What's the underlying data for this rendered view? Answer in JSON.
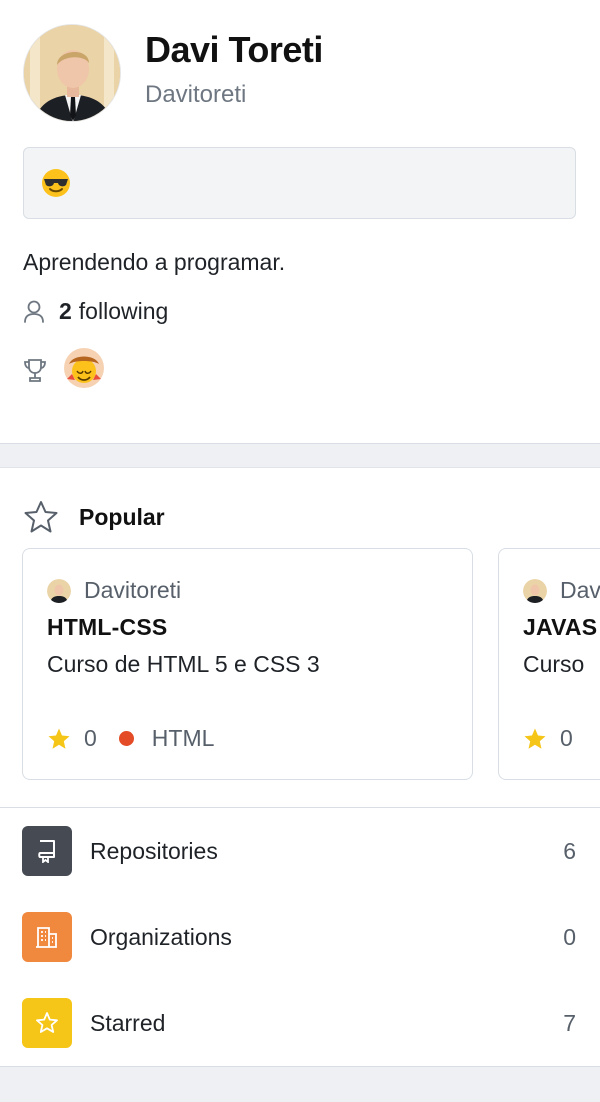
{
  "profile": {
    "name": "Davi Toreti",
    "login": "Davitoreti",
    "status_emoji": "sunglasses-emoji",
    "bio": "Aprendendo a programar.",
    "following_count": "2",
    "following_label": "following",
    "achievement_icon": "trophy-icon"
  },
  "popular": {
    "title": "Popular",
    "cards": [
      {
        "owner": "Davitoreti",
        "name": "HTML-CSS",
        "description": "Curso de HTML 5 e CSS 3",
        "stars": "0",
        "language": "HTML"
      },
      {
        "owner": "Dav",
        "name": "JAVAS",
        "description": "Curso",
        "stars": "0"
      }
    ]
  },
  "menu": {
    "items": [
      {
        "label": "Repositories",
        "count": "6",
        "icon": "repo-icon",
        "color": "#454a53"
      },
      {
        "label": "Organizations",
        "count": "0",
        "icon": "building-icon",
        "color": "#f0883e"
      },
      {
        "label": "Starred",
        "count": "7",
        "icon": "star-icon",
        "color": "#f5c518"
      }
    ]
  },
  "colors": {
    "accent_star": "#f5c518",
    "html_lang": "#e34c26"
  }
}
